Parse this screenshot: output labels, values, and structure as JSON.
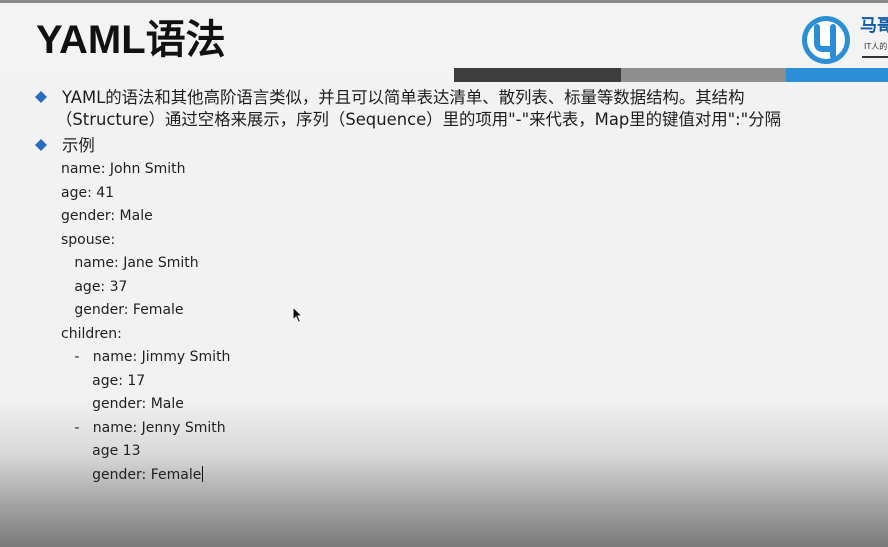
{
  "slide": {
    "title": "YAML语法",
    "logo": {
      "brand_text": "马哥",
      "sub_text": "IT人的"
    },
    "bullets": [
      {
        "lines": [
          "YAML的语法和其他高阶语言类似，并且可以简单表达清单、散列表、标量等数据结构。其结构",
          "（Structure）通过空格来展示，序列（Sequence）里的项用\"-\"来代表，Map里的键值对用\":\"分隔"
        ]
      },
      {
        "lines": [
          "示例"
        ]
      }
    ],
    "example_code": [
      "name: John Smith",
      "age: 41",
      "gender: Male",
      "spouse:",
      "   name: Jane Smith",
      "   age: 37",
      "   gender: Female",
      "children:",
      "   -   name: Jimmy Smith",
      "       age: 17",
      "       gender: Male",
      "   -   name: Jenny Smith",
      "       age 13",
      "       gender: Female"
    ]
  },
  "colors": {
    "title": "#111111",
    "bullet": "#2a6cc0",
    "bar_dark": "#3d3d3d",
    "bar_gray": "#8e8e8e",
    "bar_blue": "#2a8fd6",
    "logo_blue": "#2a8fd6"
  }
}
